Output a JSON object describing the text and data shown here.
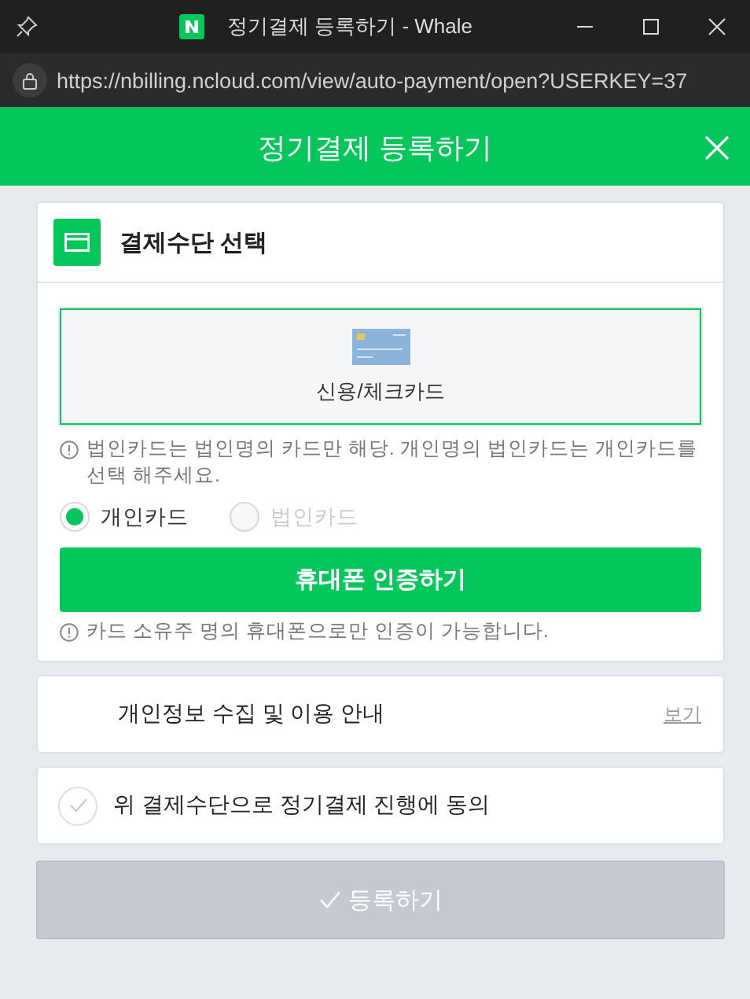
{
  "window": {
    "title": "정기결제 등록하기 - Whale",
    "url": "https://nbilling.ncloud.com/view/auto-payment/open?USERKEY=37"
  },
  "header": {
    "title": "정기결제 등록하기"
  },
  "payment": {
    "title": "결제수단 선택",
    "methods": [
      {
        "label": "신용/체크카드",
        "selected": true
      }
    ],
    "notice": "법인카드는 법인명의 카드만 해당. 개인명의 법인카드는 개인카드를 선택 해주세요.",
    "card_types": [
      {
        "label": "개인카드",
        "selected": true,
        "disabled": false
      },
      {
        "label": "법인카드",
        "selected": false,
        "disabled": true
      }
    ],
    "verify_button": "휴대폰 인증하기",
    "verify_notice": "카드 소유주 명의 휴대폰으로만 인증이 가능합니다."
  },
  "privacy": {
    "label": "개인정보 수집 및 이용 안내",
    "link": "보기"
  },
  "agree": {
    "label": "위 결제수단으로 정기결제 진행에 동의",
    "checked": false
  },
  "submit": {
    "label": "등록하기",
    "disabled": true
  }
}
